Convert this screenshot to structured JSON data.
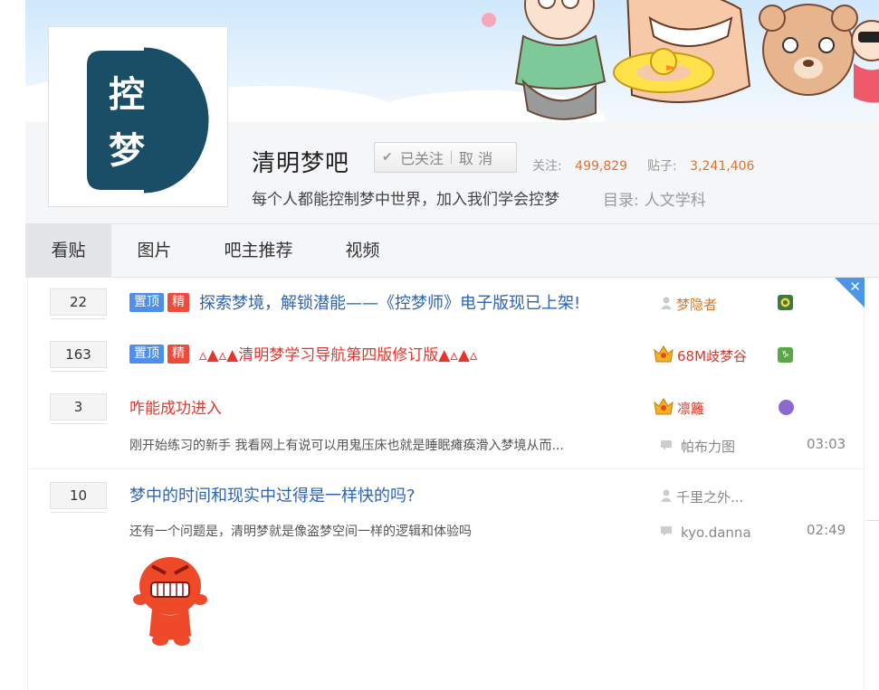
{
  "forum": {
    "name": "清明梦吧",
    "follow_label": "已关注",
    "unfollow_label": "取 消",
    "followers_label": "关注:",
    "followers": "499,829",
    "posts_label": "贴子:",
    "posts": "3,241,406",
    "slogan": "每个人都能控制梦中世界，加入我们学会控梦",
    "catalog_label": "目录:",
    "catalog_value": "人文学科",
    "logo_text": [
      "控",
      "梦"
    ]
  },
  "tabs": [
    {
      "label": "看贴"
    },
    {
      "label": "图片"
    },
    {
      "label": "吧主推荐"
    },
    {
      "label": "视频"
    }
  ],
  "threads": [
    {
      "replies": "22",
      "tag_top": "置顶",
      "tag_good": "精",
      "title": "探索梦境，解锁潜能——《控梦师》电子版现已上架!",
      "author": "梦隐者"
    },
    {
      "replies": "163",
      "tag_top": "置顶",
      "tag_good": "精",
      "title": "▵▲▵▲清明梦学习导航第四版修订版▲▵▲▵",
      "author": "68M歧梦谷"
    },
    {
      "replies": "3",
      "title": "咋能成功进入",
      "author": "凛籬",
      "abstract": "刚开始练习的新手 我看网上有说可以用鬼压床也就是睡眠瘫痪滑入梦境从而...",
      "last_replier": "帕布力图",
      "time": "03:03"
    },
    {
      "replies": "10",
      "title": "梦中的时间和现实中过得是一样快的吗?",
      "author": "千里之外...",
      "abstract": "还有一个问题是，清明梦就是像盗梦空间一样的逻辑和体验吗",
      "last_replier": "kyo.danna",
      "time": "02:49"
    }
  ],
  "close_label": "✕",
  "colors": {
    "accent_blue": "#2d64b3",
    "title_red": "#e6362c",
    "stat_orange": "#e2722f",
    "tag_blue": "#4f8fea",
    "tag_red": "#ee4b3c"
  }
}
